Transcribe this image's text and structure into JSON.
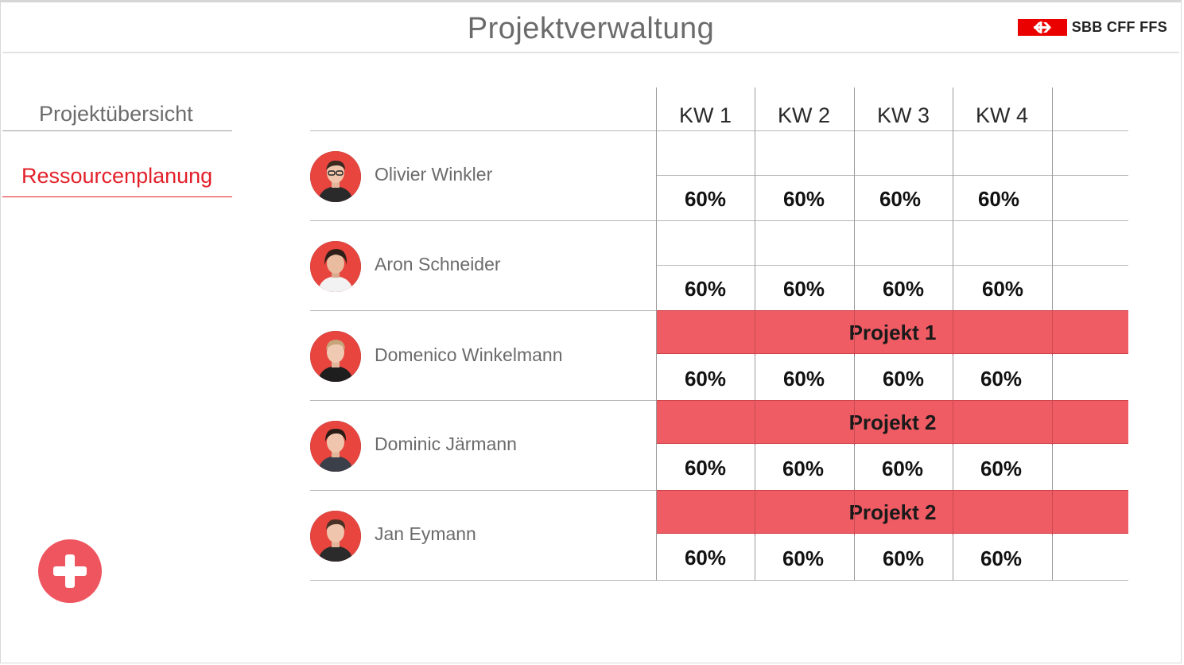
{
  "header": {
    "title": "Projektverwaltung",
    "logo_text": "SBB CFF FFS",
    "brand_color": "#eb0000"
  },
  "nav": {
    "overview_label": "Projektübersicht",
    "resources_label": "Ressourcenplanung",
    "active_color": "#e3202a"
  },
  "add_button": {
    "icon": "plus-icon",
    "color": "#ef555f"
  },
  "weeks": [
    "KW 1",
    "KW 2",
    "KW 3",
    "KW 4"
  ],
  "people": [
    {
      "name": "Olivier Winkler",
      "project": null,
      "allocations": [
        "60%",
        "60%",
        "60%",
        "60%"
      ]
    },
    {
      "name": "Aron Schneider",
      "project": null,
      "allocations": [
        "60%",
        "60%",
        "60%",
        "60%"
      ]
    },
    {
      "name": "Domenico Winkelmann",
      "project": "Projekt 1",
      "allocations": [
        "60%",
        "60%",
        "60%",
        "60%"
      ]
    },
    {
      "name": "Dominic Järmann",
      "project": "Projekt 2",
      "allocations": [
        "60%",
        "60%",
        "60%",
        "60%"
      ]
    },
    {
      "name": "Jan Eymann",
      "project": "Projekt 2",
      "allocations": [
        "60%",
        "60%",
        "60%",
        "60%"
      ]
    }
  ],
  "project_color": "#f05c64"
}
